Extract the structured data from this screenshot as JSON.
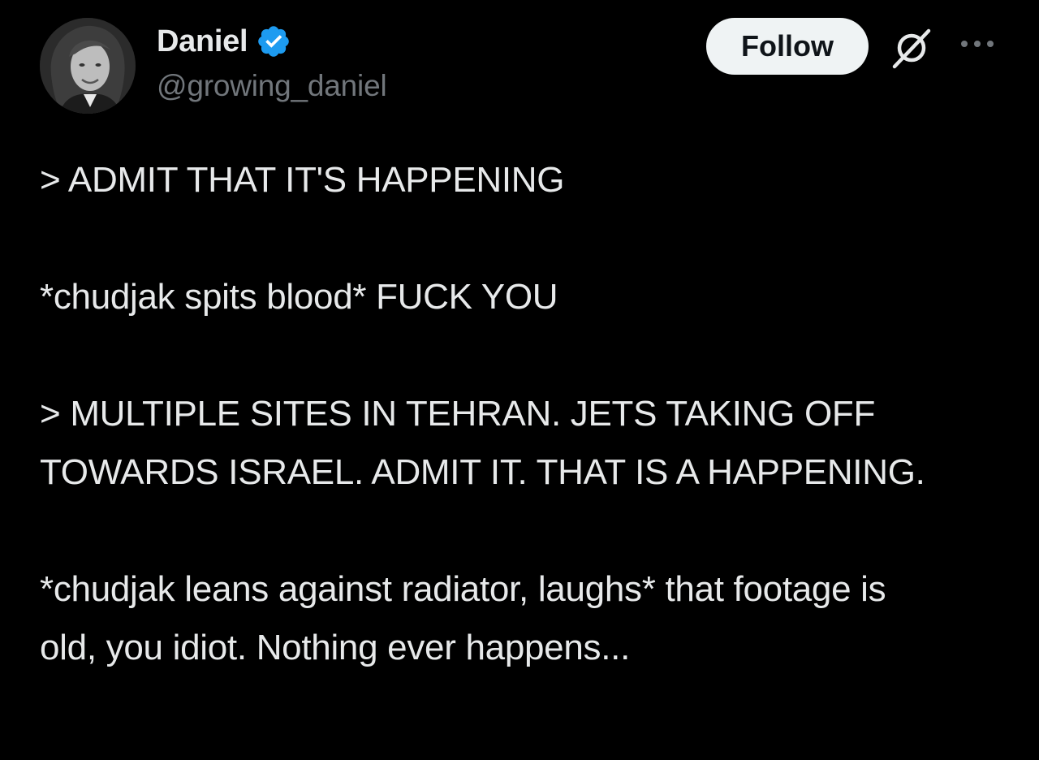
{
  "author": {
    "display_name": "Daniel",
    "handle": "@growing_daniel",
    "verified": true,
    "avatar_icon": "avatar-portrait"
  },
  "actions": {
    "follow_label": "Follow",
    "grok_icon": "grok-icon",
    "more_icon": "more-dots-icon"
  },
  "tweet": {
    "paragraphs": [
      "> ADMIT THAT IT'S HAPPENING",
      "*chudjak spits blood* FUCK YOU",
      "> MULTIPLE SITES IN TEHRAN. JETS TAKING OFF TOWARDS ISRAEL. ADMIT IT. THAT IS A HAPPENING.",
      "*chudjak leans against radiator, laughs* that footage is old, you idiot. Nothing ever happens..."
    ]
  },
  "colors": {
    "background": "#000000",
    "text_primary": "#e7e9ea",
    "text_secondary": "#71767b",
    "verified_blue": "#1d9bf0",
    "follow_bg": "#eff3f4",
    "follow_text": "#0f1419"
  }
}
